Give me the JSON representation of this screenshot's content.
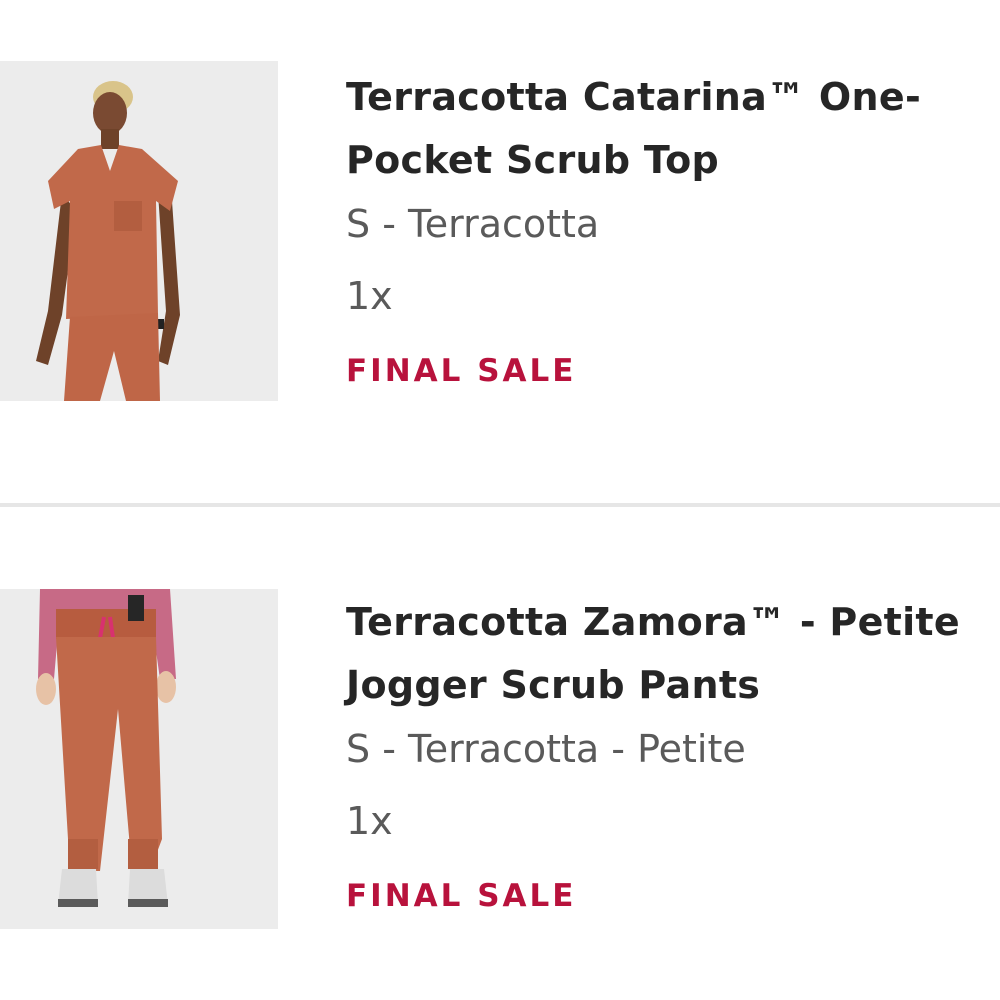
{
  "cart": {
    "items": [
      {
        "title_line1": "Terracotta Catarina™ One-",
        "title_line2": "Pocket Scrub Top",
        "variant": "S - Terracotta",
        "quantity": "1x",
        "badge": "FINAL SALE",
        "image": "product-photo-scrub-top"
      },
      {
        "title_line1": "Terracotta Zamora™ - Petite",
        "title_line2": "Jogger Scrub Pants",
        "variant": "S - Terracotta - Petite",
        "quantity": "1x",
        "badge": "FINAL SALE",
        "image": "product-photo-jogger-pants"
      }
    ]
  },
  "colors": {
    "sale": "#b8123c",
    "terracotta": "#c1694a",
    "title_text": "#262626",
    "secondary_text": "#5a5a5a"
  }
}
